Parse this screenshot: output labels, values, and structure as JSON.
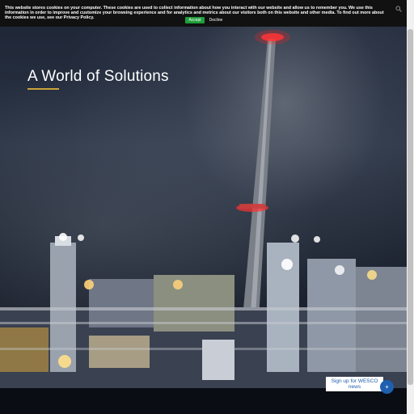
{
  "cookie_banner": {
    "text": "This website stores cookies on your computer. These cookies are used to collect information about how you interact with our website and allow us to remember you. We use this information in order to improve and customize your browsing experience and for analytics and metrics about our visitors both on this website and other media. To find out more about the cookies we use, see our Privacy Policy.",
    "accept_label": "Accept",
    "decline_label": "Decline"
  },
  "header": {
    "search_icon": "search-icon"
  },
  "hero": {
    "title": "A World of Solutions",
    "accent_color": "#c9a23a"
  },
  "signup": {
    "label": "Sign up for WESCO news",
    "button_icon": "plus-icon"
  },
  "colors": {
    "accept_button": "#1f9e3c",
    "signup_button": "#1f5fb0",
    "cookie_bar": "#111111"
  }
}
